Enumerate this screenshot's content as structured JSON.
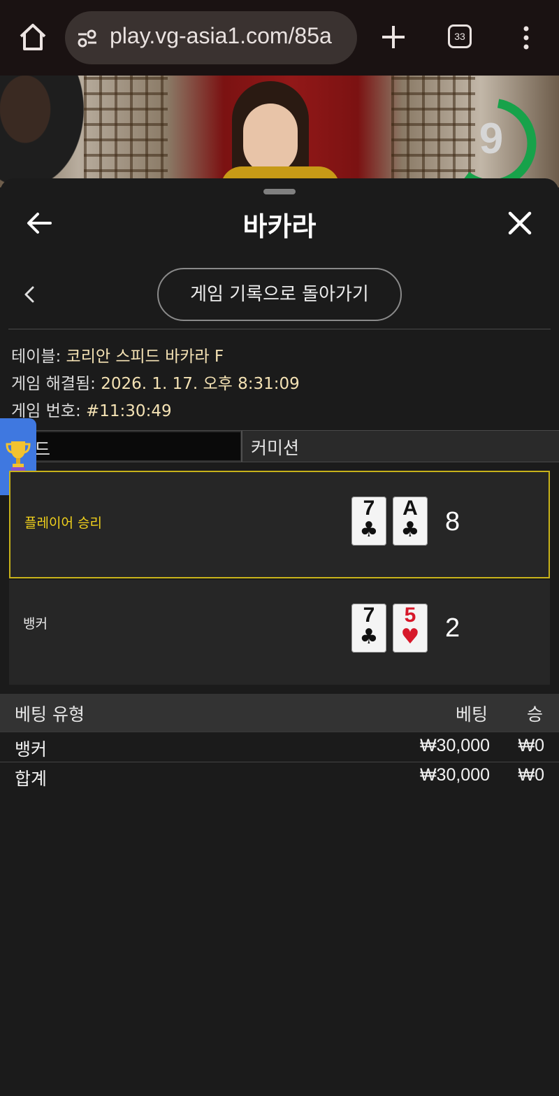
{
  "browser": {
    "url": "play.vg-asia1.com/85a",
    "tab_count": "33"
  },
  "video": {
    "countdown": "9",
    "countdown_color": "#17a24a"
  },
  "sheet": {
    "title": "바카라",
    "history_button": "게임 기록으로 돌아가기"
  },
  "details": {
    "table_label": "테이블:",
    "table_value": "코리안 스피드 바카라 F",
    "resolved_label": "게임 해결됨:",
    "resolved_value": "2026. 1. 17. 오후 8:31:09",
    "number_label": "게임 번호:",
    "number_value": "#11:30:49"
  },
  "mode": {
    "label": "모드",
    "value": "커미션"
  },
  "results": {
    "player": {
      "label": "플레이어 승리",
      "cards": [
        {
          "rank": "7",
          "suit": "♣",
          "color": "#111111"
        },
        {
          "rank": "A",
          "suit": "♣",
          "color": "#111111"
        }
      ],
      "score": "8"
    },
    "banker": {
      "label": "뱅커",
      "cards": [
        {
          "rank": "7",
          "suit": "♣",
          "color": "#111111"
        },
        {
          "rank": "5",
          "suit": "♥",
          "color": "#d7182a"
        }
      ],
      "score": "2"
    }
  },
  "bets": {
    "headers": {
      "type": "베팅 유형",
      "bet": "베팅",
      "win": "승"
    },
    "rows": [
      {
        "type": "뱅커",
        "bet": "₩30,000",
        "win": "₩0"
      },
      {
        "type": "합계",
        "bet": "₩30,000",
        "win": "₩0"
      }
    ]
  },
  "colors": {
    "accent_yellow": "#f2d21c",
    "player_border": "#c8b21a",
    "trophy_tab": "#3f78e0"
  }
}
